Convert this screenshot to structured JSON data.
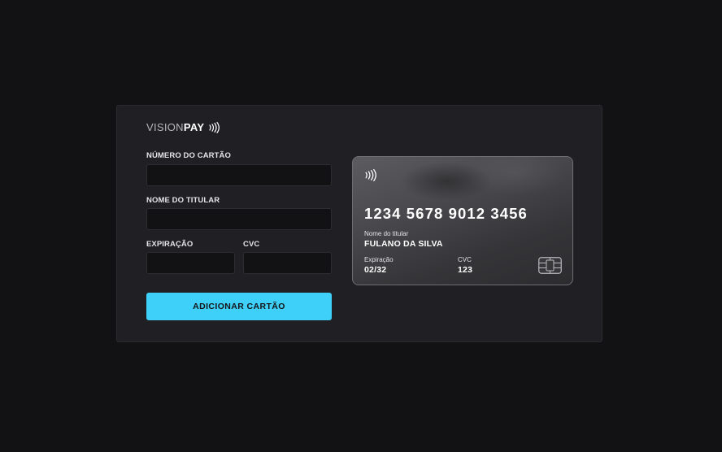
{
  "brand": {
    "name_light": "VISION",
    "name_bold": "PAY",
    "icon": "contactless-icon"
  },
  "form": {
    "card_number": {
      "label": "NÚMERO DO CARTÃO",
      "value": ""
    },
    "holder_name": {
      "label": "NOME DO TITULAR",
      "value": ""
    },
    "expiration": {
      "label": "EXPIRAÇÃO",
      "value": ""
    },
    "cvc": {
      "label": "CVC",
      "value": ""
    },
    "submit_label": "ADICIONAR CARTÃO"
  },
  "card_preview": {
    "icon": "contactless-icon",
    "number": "1234 5678 9012 3456",
    "holder_label": "Nome do titular",
    "holder_value": "FULANO DA SILVA",
    "expiration_label": "Expiração",
    "expiration_value": "02/32",
    "cvc_label": "CVC",
    "cvc_value": "123",
    "chip_icon": "chip-icon"
  },
  "colors": {
    "background": "#121214",
    "panel": "#202024",
    "accent": "#3ed0f8"
  }
}
